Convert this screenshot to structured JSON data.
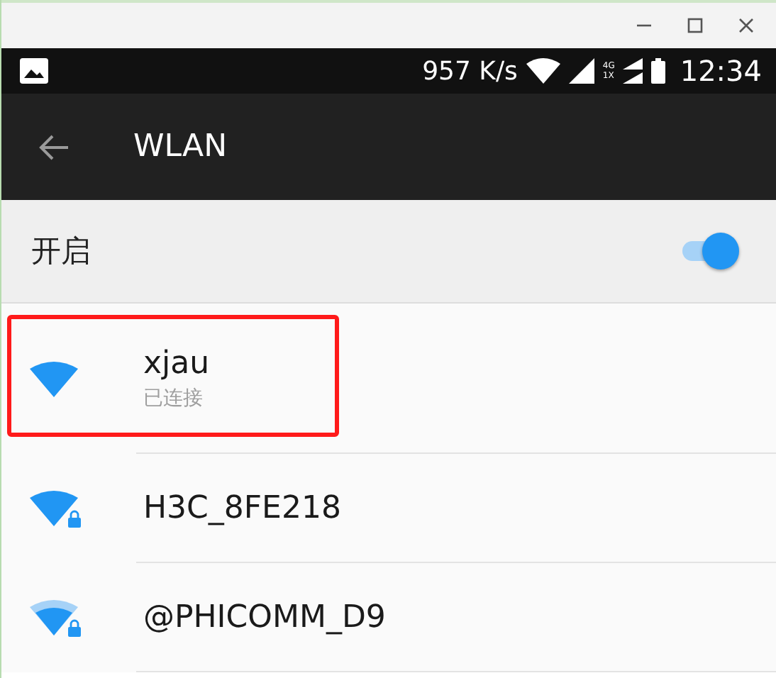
{
  "status_bar": {
    "speed": "957 K/s",
    "network_badge_top": "4G",
    "network_badge_bottom": "1X",
    "time": "12:34"
  },
  "app_bar": {
    "title": "WLAN"
  },
  "wlan_switch": {
    "label": "开启",
    "on": true
  },
  "networks": [
    {
      "name": "xjau",
      "status": "已连接",
      "kind": "full",
      "secured": false,
      "highlighted": true
    },
    {
      "name": "H3C_8FE218",
      "kind": "full",
      "secured": true,
      "highlighted": false
    },
    {
      "name": "@PHICOMM_D9",
      "kind": "partial",
      "secured": true,
      "highlighted": false
    }
  ]
}
